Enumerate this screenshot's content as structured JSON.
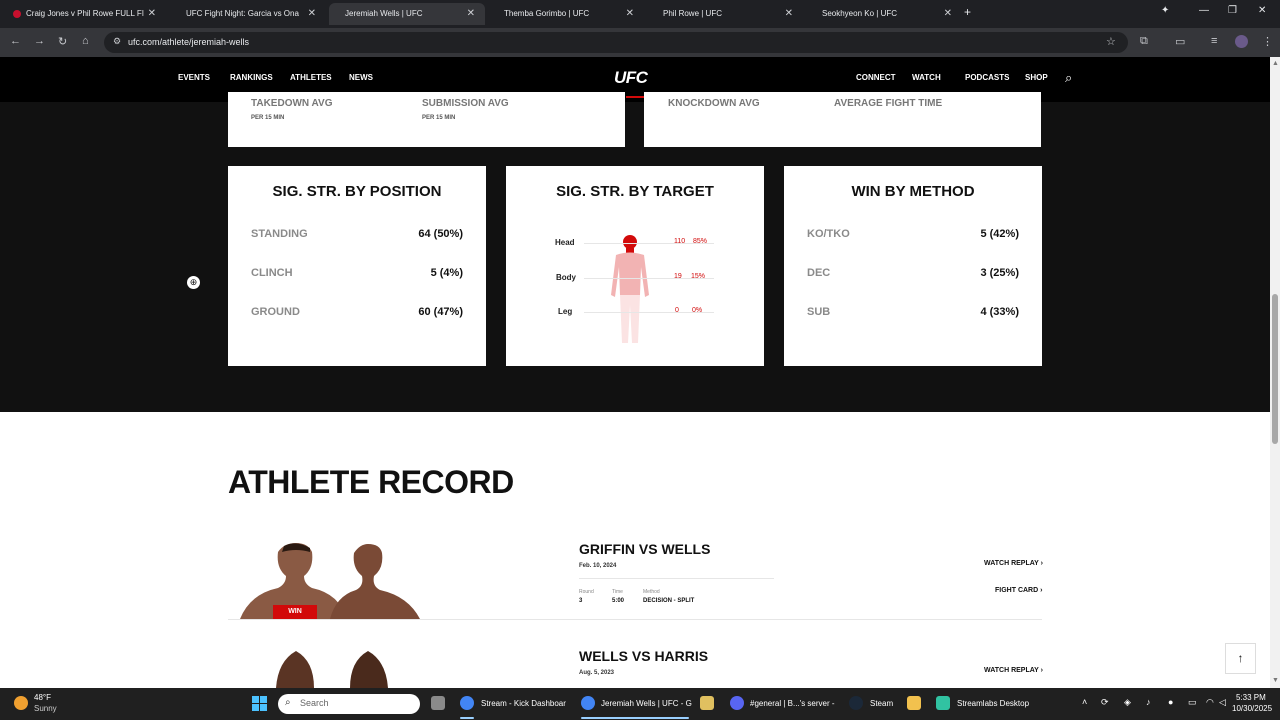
{
  "browser": {
    "tabs": [
      {
        "title": "Craig Jones v Phil Rowe FULL FI",
        "active": false
      },
      {
        "title": "UFC Fight Night: Garcia vs Ona",
        "active": false
      },
      {
        "title": "Jeremiah Wells | UFC",
        "active": true
      },
      {
        "title": "Themba Gorimbo | UFC",
        "active": false
      },
      {
        "title": "Phil Rowe | UFC",
        "active": false
      },
      {
        "title": "Seokhyeon Ko | UFC",
        "active": false
      }
    ],
    "url": "ufc.com/athlete/jeremiah-wells"
  },
  "ufc_nav": {
    "left": [
      "EVENTS",
      "RANKINGS",
      "ATHLETES",
      "NEWS"
    ],
    "logo": "UFC",
    "right": [
      "CONNECT",
      "WATCH",
      "PODCASTS",
      "SHOP"
    ]
  },
  "top_cards": {
    "left": {
      "label1": "TAKEDOWN AVG",
      "sub1": "PER 15 MIN",
      "label2": "SUBMISSION AVG",
      "sub2": "PER 15 MIN"
    },
    "right": {
      "label1": "KNOCKDOWN AVG",
      "label2": "AVERAGE FIGHT TIME"
    }
  },
  "position_card": {
    "title": "SIG. STR. BY POSITION",
    "rows": [
      {
        "label": "STANDING",
        "value": "64 (50%)"
      },
      {
        "label": "CLINCH",
        "value": "5 (4%)"
      },
      {
        "label": "GROUND",
        "value": "60 (47%)"
      }
    ]
  },
  "target_card": {
    "title": "SIG. STR. BY TARGET",
    "rows": [
      {
        "label": "Head",
        "count": "110",
        "pct": "85%"
      },
      {
        "label": "Body",
        "count": "19",
        "pct": "15%"
      },
      {
        "label": "Leg",
        "count": "0",
        "pct": "0%"
      }
    ],
    "highlight_color": "#d20a0a"
  },
  "method_card": {
    "title": "WIN BY METHOD",
    "rows": [
      {
        "label": "KO/TKO",
        "value": "5 (42%)"
      },
      {
        "label": "DEC",
        "value": "3 (25%)"
      },
      {
        "label": "SUB",
        "value": "4 (33%)"
      }
    ]
  },
  "record": {
    "title": "ATHLETE RECORD",
    "fights": [
      {
        "headline": "GRIFFIN VS WELLS",
        "date": "Feb. 10, 2024",
        "result": "WIN",
        "round_label": "Round",
        "round": "3",
        "time_label": "Time",
        "time": "5:00",
        "method_label": "Method",
        "method": "DECISION - SPLIT",
        "replay": "WATCH REPLAY",
        "fightcard": "FIGHT CARD"
      },
      {
        "headline": "WELLS VS HARRIS",
        "date": "Aug. 5, 2023",
        "replay": "WATCH REPLAY"
      }
    ]
  },
  "taskbar": {
    "weather_temp": "48°F",
    "weather_desc": "Sunny",
    "search": "Search",
    "apps": [
      {
        "label": "Stream - Kick Dashboar"
      },
      {
        "label": "Jeremiah Wells | UFC - G"
      },
      {
        "label": "#general | B...'s server -"
      },
      {
        "label": "Steam"
      },
      {
        "label": "Streamlabs Desktop"
      }
    ],
    "time": "5:33 PM",
    "date": "10/30/2025"
  }
}
